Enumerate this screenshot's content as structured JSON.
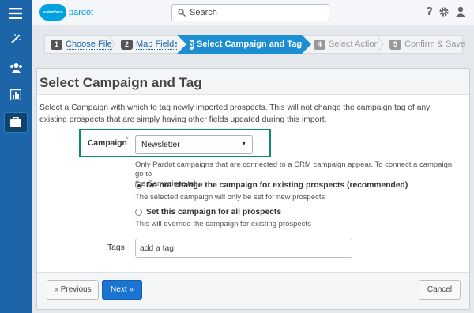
{
  "brand": {
    "cloud_text": "salesforce",
    "product": "pardot"
  },
  "search": {
    "placeholder": "Search"
  },
  "sidebar": {
    "items": [
      "menu",
      "wand",
      "prospects",
      "reports",
      "marketing"
    ]
  },
  "wizard": {
    "steps": [
      {
        "num": "1",
        "label": "Choose File",
        "state": "done"
      },
      {
        "num": "2",
        "label": "Map Fields",
        "state": "done"
      },
      {
        "num": "3",
        "label": "Select Campaign and Tag",
        "state": "active"
      },
      {
        "num": "4",
        "label": "Select Action",
        "state": "future"
      },
      {
        "num": "5",
        "label": "Confirm & Save",
        "state": "future"
      }
    ]
  },
  "page": {
    "title": "Select Campaign and Tag",
    "intro": "Select a Campaign with which to tag newly imported prospects. This will not change the campaign tag of any existing prospects that are simply having other fields updated during this import."
  },
  "campaign": {
    "label": "Campaign",
    "required_mark": "*",
    "selected": "Newsletter",
    "hint_line1": "Only Pardot campaigns that are connected to a CRM campaign appear. To connect a campaign, go to",
    "hint_line2": "the Campaigns tab."
  },
  "options": [
    {
      "label": "Do not change the campaign for existing prospects (recommended)",
      "hint": "The selected campaign will only be set for new prospects",
      "checked": true
    },
    {
      "label": "Set this campaign for all prospects",
      "hint": "This will override the campaign for existing prospects",
      "checked": false
    }
  ],
  "tags": {
    "label": "Tags",
    "placeholder": "add a tag"
  },
  "buttons": {
    "previous": "« Previous",
    "next": "Next »",
    "cancel": "Cancel"
  },
  "colors": {
    "sidebar": "#1b65a8",
    "active_step": "#1b8fd2",
    "highlight_border": "#0e8a6e",
    "primary_button": "#1b74d2"
  }
}
